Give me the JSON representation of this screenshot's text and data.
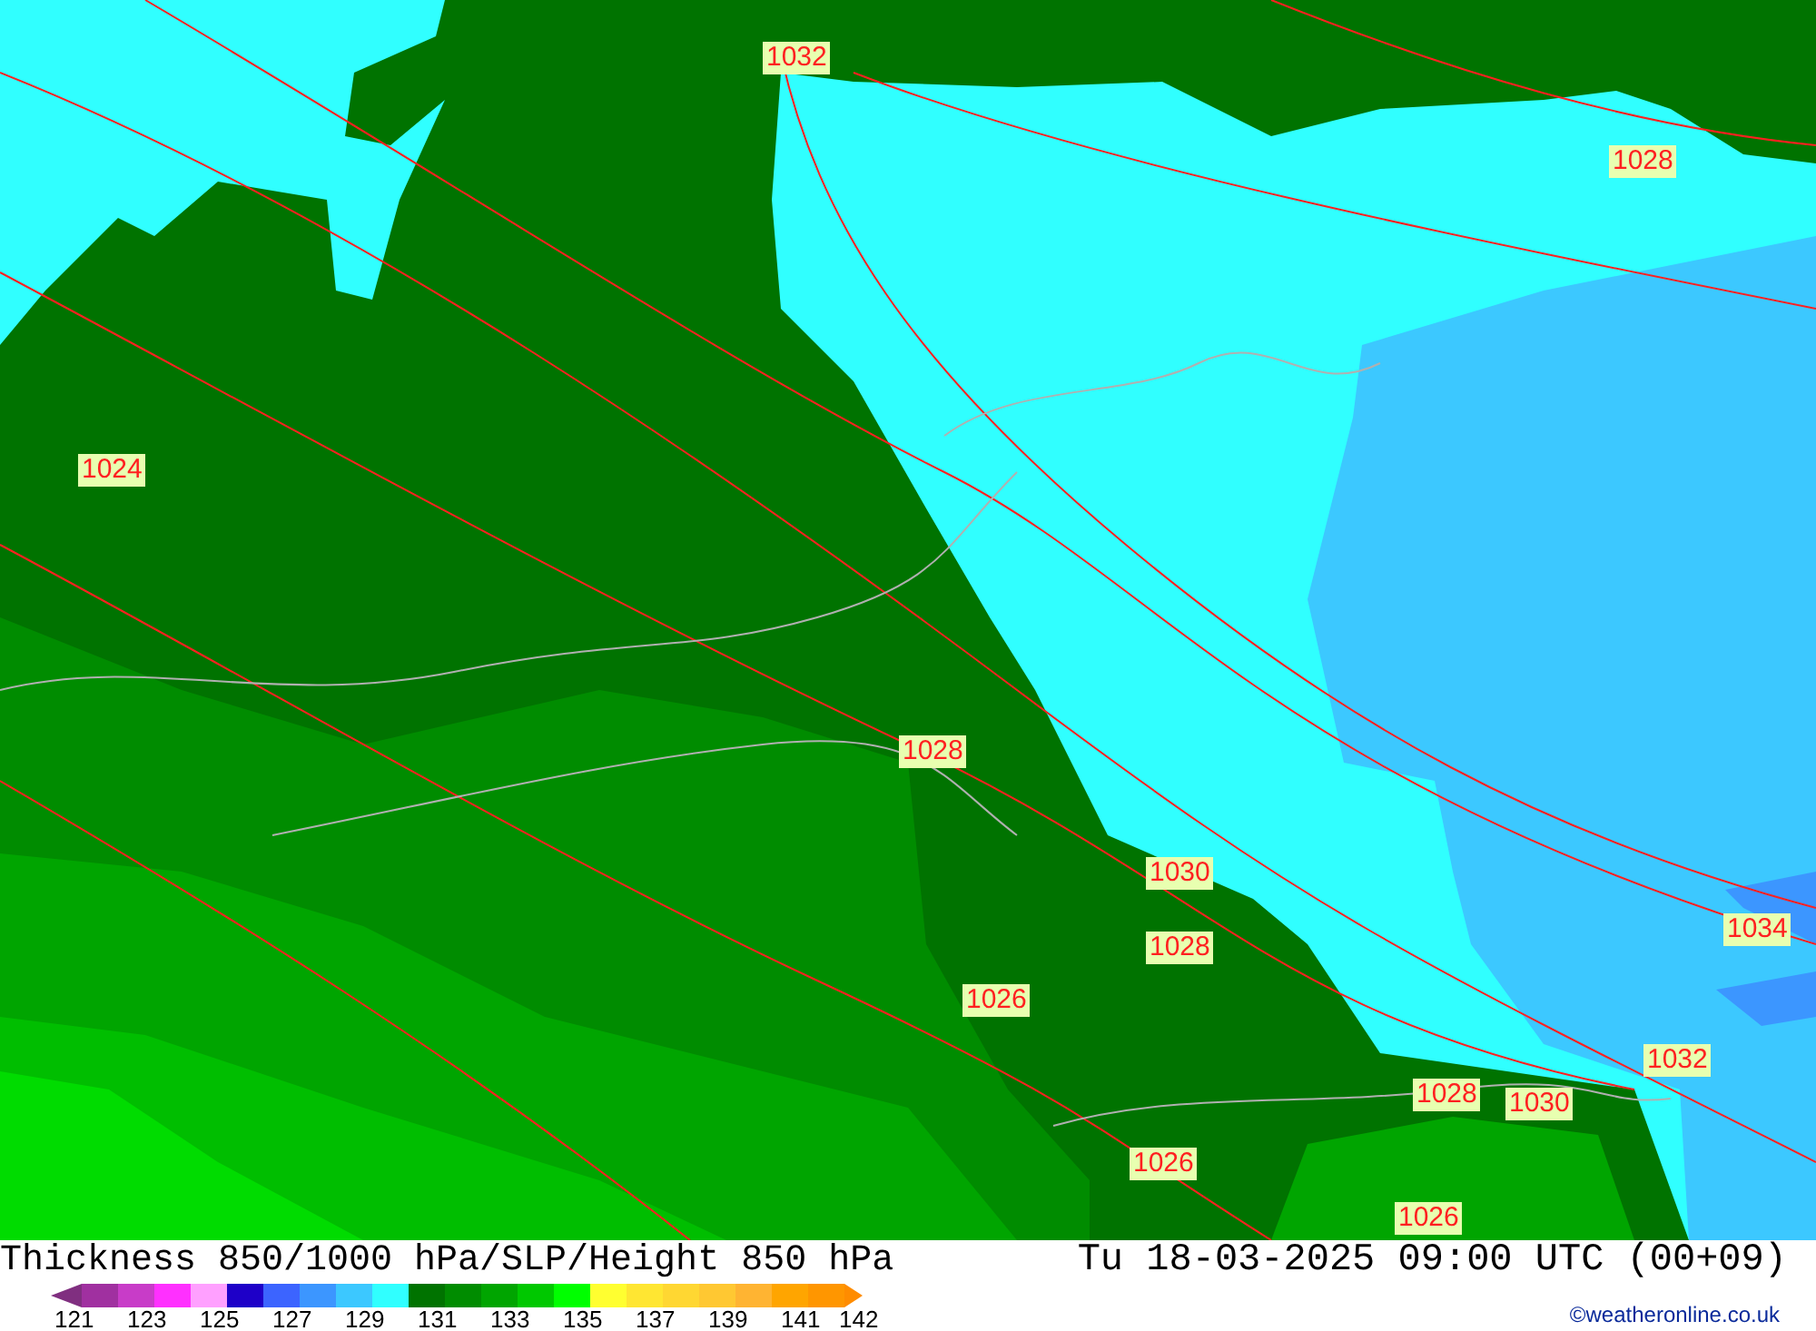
{
  "map": {
    "isobar_labels": [
      {
        "text": "1032"
      },
      {
        "text": "1028"
      },
      {
        "text": "1024"
      },
      {
        "text": "1028"
      },
      {
        "text": "1030"
      },
      {
        "text": "1028"
      },
      {
        "text": "1026"
      },
      {
        "text": "1034"
      },
      {
        "text": "1032"
      },
      {
        "text": "1028"
      },
      {
        "text": "1030"
      },
      {
        "text": "1026"
      },
      {
        "text": "1026"
      }
    ]
  },
  "footer": {
    "title": "Thickness 850/1000 hPa/SLP/Height 850 hPa",
    "valid_time": "Tu 18-03-2025 09:00 UTC (00+09)",
    "legend": {
      "swatches": [
        {
          "color": "#a030a0"
        },
        {
          "color": "#c83cc8"
        },
        {
          "color": "#ff30ff"
        },
        {
          "color": "#ffa0ff"
        },
        {
          "color": "#1e00c8"
        },
        {
          "color": "#3c64ff"
        },
        {
          "color": "#3c96ff"
        },
        {
          "color": "#3cc8ff"
        },
        {
          "color": "#30ffff"
        },
        {
          "color": "#007300"
        },
        {
          "color": "#008c00"
        },
        {
          "color": "#00a500"
        },
        {
          "color": "#00c800"
        },
        {
          "color": "#00ff00"
        },
        {
          "color": "#ffff30"
        },
        {
          "color": "#ffe632"
        },
        {
          "color": "#ffd732"
        },
        {
          "color": "#ffc832"
        },
        {
          "color": "#ffb432"
        },
        {
          "color": "#ffa500"
        },
        {
          "color": "#ff9600"
        }
      ],
      "labels": [
        "121",
        "123",
        "125",
        "127",
        "129",
        "131",
        "133",
        "135",
        "137",
        "139",
        "141",
        "142"
      ]
    },
    "credit": "©weatheronline.co.uk"
  }
}
